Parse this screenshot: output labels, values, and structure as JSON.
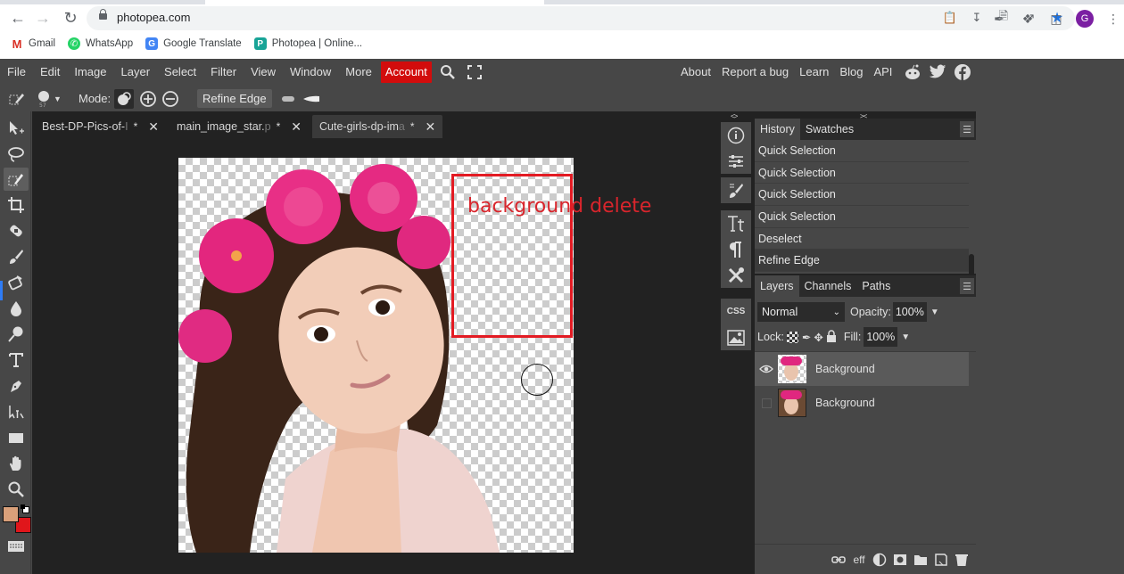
{
  "browser": {
    "url": "photopea.com",
    "bookmarks": [
      {
        "label": "Gmail",
        "icon": "gmail-icon"
      },
      {
        "label": "WhatsApp",
        "icon": "whatsapp-icon"
      },
      {
        "label": "Google Translate",
        "icon": "google-translate-icon"
      },
      {
        "label": "Photopea | Online...",
        "icon": "photopea-icon"
      }
    ],
    "profile_initial": "G"
  },
  "menubar": {
    "items": [
      "File",
      "Edit",
      "Image",
      "Layer",
      "Select",
      "Filter",
      "View",
      "Window",
      "More"
    ],
    "account": "Account",
    "right_links": [
      "About",
      "Report a bug",
      "Learn",
      "Blog",
      "API"
    ],
    "accent": "#d20c0c"
  },
  "options": {
    "mode_label": "Mode:",
    "refine_edge": "Refine Edge",
    "brush_size": "57"
  },
  "doc_tabs": [
    {
      "name": "Best-DP-Pics-of-",
      "fade": "I",
      "modified": "*",
      "active": false
    },
    {
      "name": "main_image_star.",
      "fade": "p",
      "modified": "*",
      "active": false
    },
    {
      "name": "Cute-girls-dp-im",
      "fade": "a",
      "modified": "*",
      "active": true
    }
  ],
  "canvas": {
    "annotation": "background delete",
    "annotation_color": "#e31b23"
  },
  "history": {
    "tabs": [
      "History",
      "Swatches"
    ],
    "items": [
      "Quick Selection",
      "Quick Selection",
      "Quick Selection",
      "Quick Selection",
      "Deselect",
      "Refine Edge"
    ],
    "selected_index": 5
  },
  "layers": {
    "tabs": [
      "Layers",
      "Channels",
      "Paths"
    ],
    "blend_mode": "Normal",
    "opacity_label": "Opacity:",
    "opacity": "100%",
    "lock_label": "Lock:",
    "fill_label": "Fill:",
    "fill": "100%",
    "items": [
      {
        "name": "Background",
        "visible": true,
        "selected": true
      },
      {
        "name": "Background",
        "visible": false,
        "selected": false
      }
    ],
    "footer_eff": "eff"
  },
  "colors": {
    "foreground": "#d9a07a",
    "background": "#e0161b"
  }
}
